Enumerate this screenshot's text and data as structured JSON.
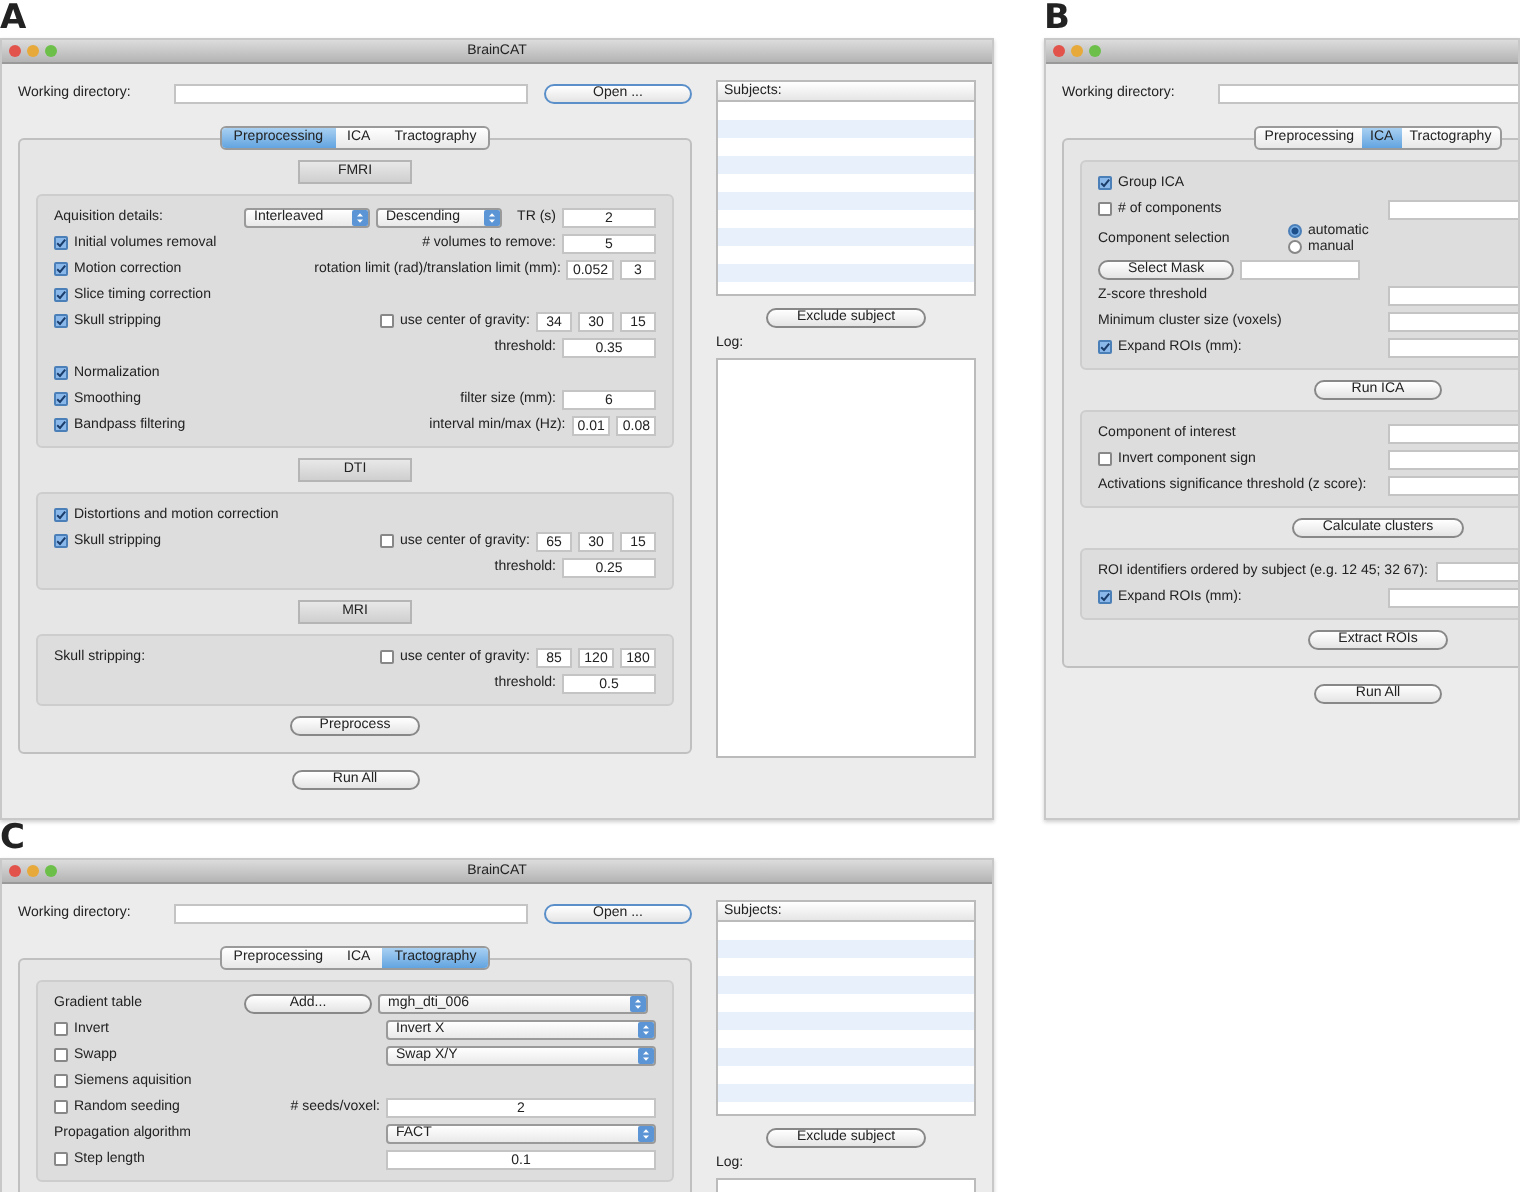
{
  "panels": [
    {
      "letter": "A",
      "window": {
        "title": "BrainCAT",
        "working_directory_label": "Working directory:",
        "open_button": "Open ...",
        "tabs": [
          {
            "label": "Preprocessing",
            "selected": true
          },
          {
            "label": "ICA",
            "selected": false
          },
          {
            "label": "Tractography",
            "selected": false
          }
        ],
        "blocks": [
          {
            "kind": "header",
            "label": "FMRI"
          },
          {
            "kind": "group",
            "rows": [
              {
                "left": [
                  {
                    "kind": "label",
                    "text": "Aquisition details:"
                  },
                  {
                    "kind": "select",
                    "value": "Interleaved"
                  },
                  {
                    "kind": "select",
                    "value": "Descending"
                  }
                ],
                "right": [
                  {
                    "kind": "label",
                    "text": "TR (s)"
                  },
                  {
                    "kind": "field",
                    "value": "2"
                  }
                ]
              },
              {
                "left": [
                  {
                    "kind": "check",
                    "label": "Initial volumes removal",
                    "checked": true
                  }
                ],
                "right": [
                  {
                    "kind": "label",
                    "text": "# volumes to remove:"
                  },
                  {
                    "kind": "field",
                    "value": "5"
                  }
                ]
              },
              {
                "left": [
                  {
                    "kind": "check",
                    "label": "Motion correction",
                    "checked": true
                  }
                ],
                "right": [
                  {
                    "kind": "label",
                    "text": "rotation limit (rad)/translation limit (mm):"
                  },
                  {
                    "kind": "small_field",
                    "value": "0.052"
                  },
                  {
                    "kind": "small_field",
                    "value": "3"
                  }
                ]
              },
              {
                "left": [
                  {
                    "kind": "check",
                    "label": "Slice timing correction",
                    "checked": true
                  }
                ]
              },
              {
                "left": [
                  {
                    "kind": "check",
                    "label": "Skull stripping",
                    "checked": true
                  }
                ],
                "right": [
                  {
                    "kind": "check",
                    "label": "use center of gravity:",
                    "checked": false
                  },
                  {
                    "kind": "small_field",
                    "value": "34"
                  },
                  {
                    "kind": "small_field",
                    "value": "30"
                  },
                  {
                    "kind": "small_field",
                    "value": "15"
                  }
                ]
              },
              {
                "right": [
                  {
                    "kind": "label",
                    "text": "threshold:"
                  },
                  {
                    "kind": "field",
                    "value": "0.35"
                  }
                ]
              },
              {
                "left": [
                  {
                    "kind": "check",
                    "label": "Normalization",
                    "checked": true
                  }
                ]
              },
              {
                "left": [
                  {
                    "kind": "check",
                    "label": "Smoothing",
                    "checked": true
                  }
                ],
                "right": [
                  {
                    "kind": "label",
                    "text": "filter size (mm):"
                  },
                  {
                    "kind": "field",
                    "value": "6"
                  }
                ]
              },
              {
                "left": [
                  {
                    "kind": "check",
                    "label": "Bandpass filtering",
                    "checked": true
                  }
                ],
                "right": [
                  {
                    "kind": "label",
                    "text": "interval  min/max (Hz):"
                  },
                  {
                    "kind": "small_field",
                    "value": "0.01"
                  },
                  {
                    "kind": "small_field",
                    "value": "0.08"
                  }
                ]
              }
            ]
          },
          {
            "kind": "header",
            "label": "DTI"
          },
          {
            "kind": "group",
            "rows": [
              {
                "left": [
                  {
                    "kind": "check",
                    "label": "Distortions and motion correction",
                    "checked": true
                  }
                ]
              },
              {
                "left": [
                  {
                    "kind": "check",
                    "label": "Skull stripping",
                    "checked": true
                  }
                ],
                "right": [
                  {
                    "kind": "check",
                    "label": "use center of gravity:",
                    "checked": false
                  },
                  {
                    "kind": "small_field",
                    "value": "65"
                  },
                  {
                    "kind": "small_field",
                    "value": "30"
                  },
                  {
                    "kind": "small_field",
                    "value": "15"
                  }
                ]
              },
              {
                "right": [
                  {
                    "kind": "label",
                    "text": "threshold:"
                  },
                  {
                    "kind": "field",
                    "value": "0.25"
                  }
                ]
              }
            ]
          },
          {
            "kind": "header",
            "label": "MRI"
          },
          {
            "kind": "group",
            "rows": [
              {
                "left": [
                  {
                    "kind": "label",
                    "text": "Skull stripping:"
                  }
                ],
                "right": [
                  {
                    "kind": "check",
                    "label": "use center of gravity:",
                    "checked": false
                  },
                  {
                    "kind": "small_field",
                    "value": "85"
                  },
                  {
                    "kind": "small_field",
                    "value": "120"
                  },
                  {
                    "kind": "small_field",
                    "value": "180"
                  }
                ]
              },
              {
                "right": [
                  {
                    "kind": "label",
                    "text": "threshold:"
                  },
                  {
                    "kind": "field",
                    "value": "0.5"
                  }
                ]
              }
            ]
          },
          {
            "kind": "button",
            "label": "Preprocess"
          }
        ],
        "footer_button": "Run All",
        "sidebar": {
          "subjects_label": "Subjects:",
          "exclude_button": "Exclude subject",
          "log_label": "Log:"
        }
      }
    },
    {
      "letter": "B",
      "window": {
        "working_directory_label": "Working directory:",
        "tabs": [
          {
            "label": "Preprocessing",
            "selected": false
          },
          {
            "label": "ICA",
            "selected": true
          },
          {
            "label": "Tractography",
            "selected": false
          }
        ],
        "blocks": [
          {
            "kind": "group",
            "rows": [
              {
                "left": [
                  {
                    "kind": "check",
                    "label": "Group ICA",
                    "checked": true
                  }
                ]
              },
              {
                "left": [
                  {
                    "kind": "check",
                    "label": "# of components",
                    "checked": false
                  }
                ],
                "right": [
                  {
                    "kind": "wide_field"
                  }
                ]
              },
              {
                "left": [
                  {
                    "kind": "label",
                    "text": "Component selection"
                  },
                  {
                    "kind": "radios",
                    "options": [
                      {
                        "label": "automatic",
                        "selected": true
                      },
                      {
                        "label": "manual",
                        "selected": false
                      }
                    ]
                  }
                ]
              },
              {
                "left": [
                  {
                    "kind": "button",
                    "label": "Select Mask"
                  },
                  {
                    "kind": "long_field"
                  }
                ]
              },
              {
                "left": [
                  {
                    "kind": "label",
                    "text": "Z-score threshold"
                  }
                ],
                "right": [
                  {
                    "kind": "wide_field"
                  }
                ]
              },
              {
                "left": [
                  {
                    "kind": "label",
                    "text": "Minimum cluster size (voxels)"
                  }
                ],
                "right": [
                  {
                    "kind": "wide_field"
                  }
                ]
              },
              {
                "left": [
                  {
                    "kind": "check",
                    "label": "Expand ROIs (mm):",
                    "checked": true
                  }
                ],
                "right": [
                  {
                    "kind": "wide_field"
                  }
                ]
              }
            ]
          },
          {
            "kind": "button",
            "label": "Run ICA"
          },
          {
            "kind": "group",
            "rows": [
              {
                "left": [
                  {
                    "kind": "label",
                    "text": "Component of interest"
                  }
                ],
                "right": [
                  {
                    "kind": "wide_field"
                  }
                ]
              },
              {
                "left": [
                  {
                    "kind": "check",
                    "label": "Invert component sign",
                    "checked": false
                  }
                ],
                "right": [
                  {
                    "kind": "wide_field"
                  }
                ]
              },
              {
                "left": [
                  {
                    "kind": "label",
                    "text": "Activations significance threshold (z score):"
                  }
                ],
                "right": [
                  {
                    "kind": "wide_field"
                  }
                ]
              }
            ]
          },
          {
            "kind": "button",
            "label": "Calculate clusters"
          },
          {
            "kind": "group",
            "rows": [
              {
                "left": [
                  {
                    "kind": "label",
                    "text": "ROI identifiers ordered by subject (e.g. 12 45; 32 67):"
                  }
                ],
                "right": [
                  {
                    "kind": "wide_field"
                  }
                ]
              },
              {
                "left": [
                  {
                    "kind": "check",
                    "label": "Expand ROIs (mm):",
                    "checked": true
                  }
                ],
                "right": [
                  {
                    "kind": "wide_field"
                  }
                ]
              }
            ]
          },
          {
            "kind": "button",
            "label": "Extract ROIs"
          }
        ],
        "footer_button": "Run All"
      }
    },
    {
      "letter": "C",
      "window": {
        "title": "BrainCAT",
        "working_directory_label": "Working directory:",
        "open_button": "Open ...",
        "tabs": [
          {
            "label": "Preprocessing",
            "selected": false
          },
          {
            "label": "ICA",
            "selected": false
          },
          {
            "label": "Tractography",
            "selected": true
          }
        ],
        "blocks": [
          {
            "kind": "group",
            "rows": [
              {
                "left": [
                  {
                    "kind": "label",
                    "text": "Gradient table"
                  },
                  {
                    "kind": "button",
                    "label": "Add..."
                  },
                  {
                    "kind": "wide_select",
                    "value": "mgh_dti_006"
                  }
                ]
              },
              {
                "left": [
                  {
                    "kind": "check",
                    "label": "Invert",
                    "checked": false
                  }
                ],
                "right": [
                  {
                    "kind": "wide_select",
                    "value": "Invert X"
                  }
                ]
              },
              {
                "left": [
                  {
                    "kind": "check",
                    "label": "Swapp",
                    "checked": false
                  }
                ],
                "right": [
                  {
                    "kind": "wide_select",
                    "value": "Swap X/Y"
                  }
                ]
              },
              {
                "left": [
                  {
                    "kind": "check",
                    "label": "Siemens aquisition",
                    "checked": false
                  }
                ]
              },
              {
                "left": [
                  {
                    "kind": "check",
                    "label": "Random seeding",
                    "checked": false
                  }
                ],
                "right": [
                  {
                    "kind": "label",
                    "text": "# seeds/voxel:"
                  },
                  {
                    "kind": "wide_field",
                    "value": "2"
                  }
                ]
              },
              {
                "left": [
                  {
                    "kind": "label",
                    "text": "Propagation algorithm"
                  }
                ],
                "right": [
                  {
                    "kind": "wide_select",
                    "value": "FACT"
                  }
                ]
              },
              {
                "left": [
                  {
                    "kind": "check",
                    "label": "Step length",
                    "checked": false
                  }
                ],
                "right": [
                  {
                    "kind": "wide_field",
                    "value": "0.1"
                  }
                ]
              }
            ]
          }
        ],
        "sidebar": {
          "subjects_label": "Subjects:",
          "exclude_button": "Exclude subject",
          "log_label": "Log:"
        }
      }
    }
  ]
}
